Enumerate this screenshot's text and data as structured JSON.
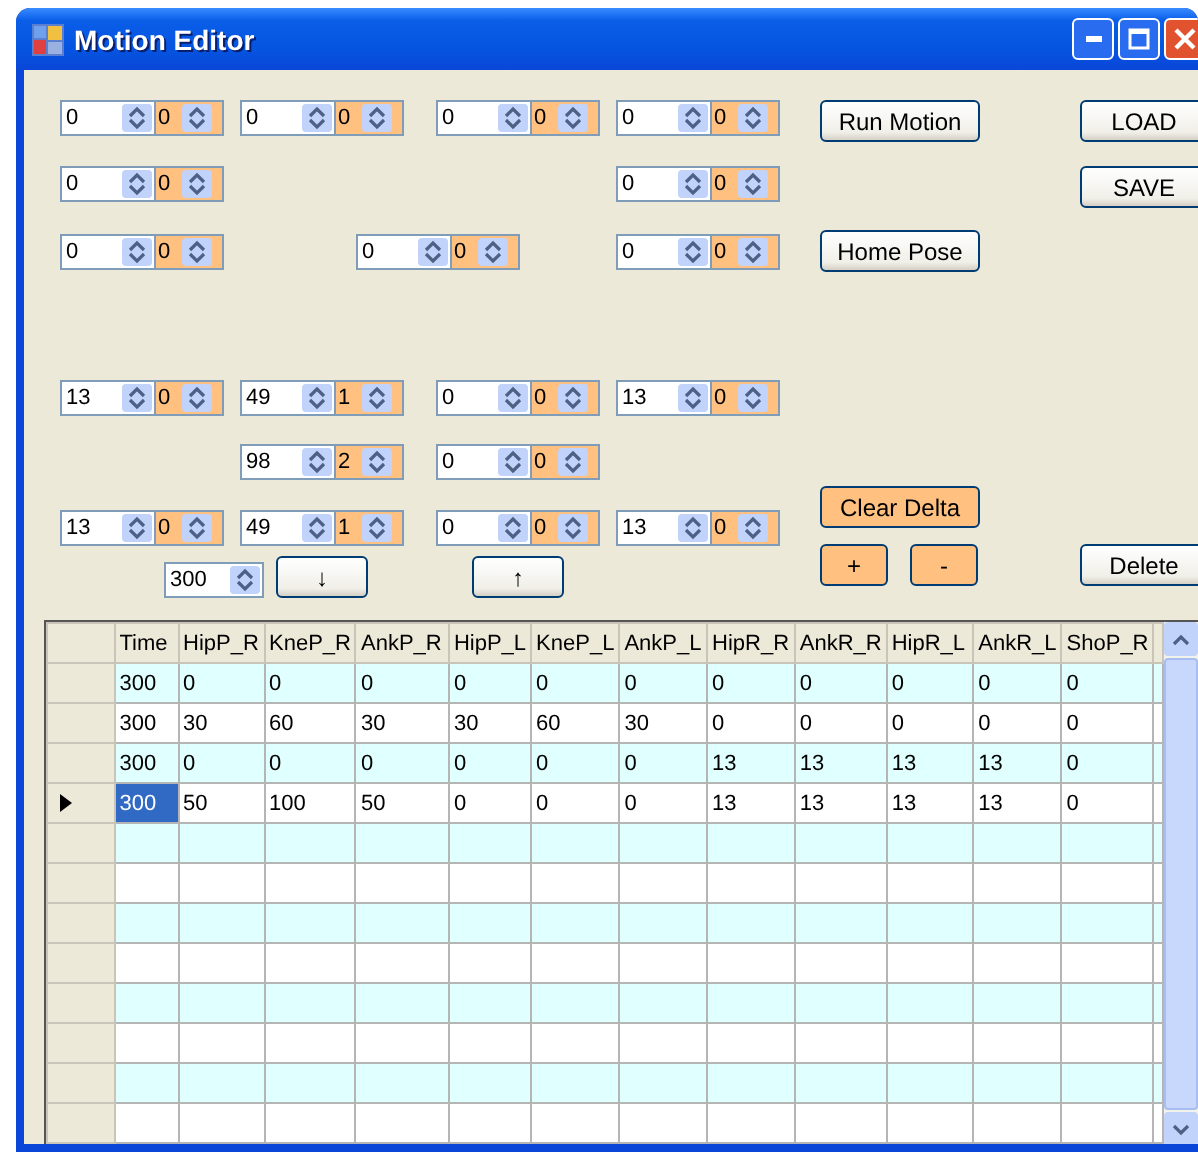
{
  "window": {
    "title": "Motion Editor"
  },
  "spinner_rows": [
    [
      {
        "value": "0",
        "delta": "0"
      },
      {
        "value": "0",
        "delta": "0"
      },
      {
        "value": "0",
        "delta": "0"
      },
      {
        "value": "0",
        "delta": "0"
      }
    ],
    [
      {
        "value": "0",
        "delta": "0"
      },
      {
        "value": "0",
        "delta": "0"
      }
    ],
    [
      {
        "value": "0",
        "delta": "0"
      },
      {
        "value": "0",
        "delta": "0"
      },
      {
        "value": "0",
        "delta": "0"
      }
    ],
    [
      {
        "value": "13",
        "delta": "0"
      },
      {
        "value": "49",
        "delta": "1"
      },
      {
        "value": "0",
        "delta": "0"
      },
      {
        "value": "13",
        "delta": "0"
      }
    ],
    [
      {
        "value": "98",
        "delta": "2"
      },
      {
        "value": "0",
        "delta": "0"
      }
    ],
    [
      {
        "value": "13",
        "delta": "0"
      },
      {
        "value": "49",
        "delta": "1"
      },
      {
        "value": "0",
        "delta": "0"
      },
      {
        "value": "13",
        "delta": "0"
      }
    ]
  ],
  "time_spinner": {
    "value": "300"
  },
  "buttons": [
    {
      "label": "Run Motion",
      "kind": "plain"
    },
    {
      "label": "LOAD",
      "kind": "plain"
    },
    {
      "label": "SAVE",
      "kind": "plain"
    },
    {
      "label": "Home Pose",
      "kind": "plain"
    },
    {
      "label": "Clear Delta",
      "kind": "accent"
    },
    {
      "label": "+",
      "kind": "accent"
    },
    {
      "label": "-",
      "kind": "accent"
    },
    {
      "label": "Delete",
      "kind": "plain"
    },
    {
      "label": "↓",
      "kind": "plain"
    },
    {
      "label": "↑",
      "kind": "plain"
    }
  ],
  "table": {
    "columns": [
      "Time",
      "HipP_R",
      "KneP_R",
      "AnkP_R",
      "HipP_L",
      "KneP_L",
      "AnkP_L",
      "HipR_R",
      "AnkR_R",
      "HipR_L",
      "AnkR_L",
      "ShoP_R"
    ],
    "rows": [
      {
        "selected": false,
        "cells": [
          "300",
          "0",
          "0",
          "0",
          "0",
          "0",
          "0",
          "0",
          "0",
          "0",
          "0",
          "0"
        ]
      },
      {
        "selected": false,
        "cells": [
          "300",
          "30",
          "60",
          "30",
          "30",
          "60",
          "30",
          "0",
          "0",
          "0",
          "0",
          "0"
        ]
      },
      {
        "selected": false,
        "cells": [
          "300",
          "0",
          "0",
          "0",
          "0",
          "0",
          "0",
          "13",
          "13",
          "13",
          "13",
          "0"
        ]
      },
      {
        "selected": true,
        "cells": [
          "300",
          "50",
          "100",
          "50",
          "0",
          "0",
          "0",
          "13",
          "13",
          "13",
          "13",
          "0"
        ]
      }
    ]
  }
}
